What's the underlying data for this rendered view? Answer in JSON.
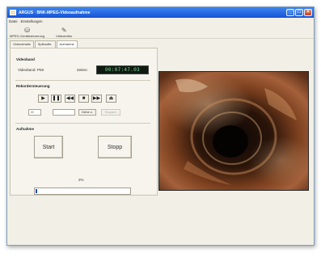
{
  "window": {
    "title": "ARGUS · BNK-MPEG-Videoaufnahme",
    "min": "_",
    "max": "□",
    "close": "×"
  },
  "menu": [
    "Datei",
    "Einstellungen"
  ],
  "toolbar": [
    {
      "label": "MPEG-Geräte­steuerung",
      "icon": "device-icon"
    },
    {
      "label": "Videoeditor",
      "icon": "editor-icon"
    }
  ],
  "tabs": [
    "Videodetails",
    "Splitaufbr.",
    "Aufnahme"
  ],
  "active_tab_index": 2,
  "videoband": {
    "title": "Videoband",
    "band_label": "Videoband: PMI",
    "zeit_label": "Zeiten:",
    "counter": "00:07:47.03"
  },
  "recorder": {
    "title": "Rekordersteuerung",
    "buttons": [
      {
        "name": "play-button",
        "glyph": "▶"
      },
      {
        "name": "pause-button",
        "glyph": "❚❚"
      },
      {
        "name": "rewind-button",
        "glyph": "◀◀"
      },
      {
        "name": "stop-button",
        "glyph": "■"
      },
      {
        "name": "fast-forward-button",
        "glyph": "▶▶"
      },
      {
        "name": "eject-button",
        "glyph": "⏏"
      }
    ],
    "field_small": "IX",
    "field_wide": "",
    "goto_label": "Gehe z.",
    "disabled_label": "Stoppen"
  },
  "aufnahme": {
    "title": "Aufnahme",
    "start": "Start",
    "stopp": "Stopp",
    "progress_value": "2%",
    "progress_fraction": 0.02
  },
  "colors": {
    "titlebar": "#1f5fde",
    "counter_bg": "#0e1a10",
    "progress": "#1e4fb5"
  }
}
